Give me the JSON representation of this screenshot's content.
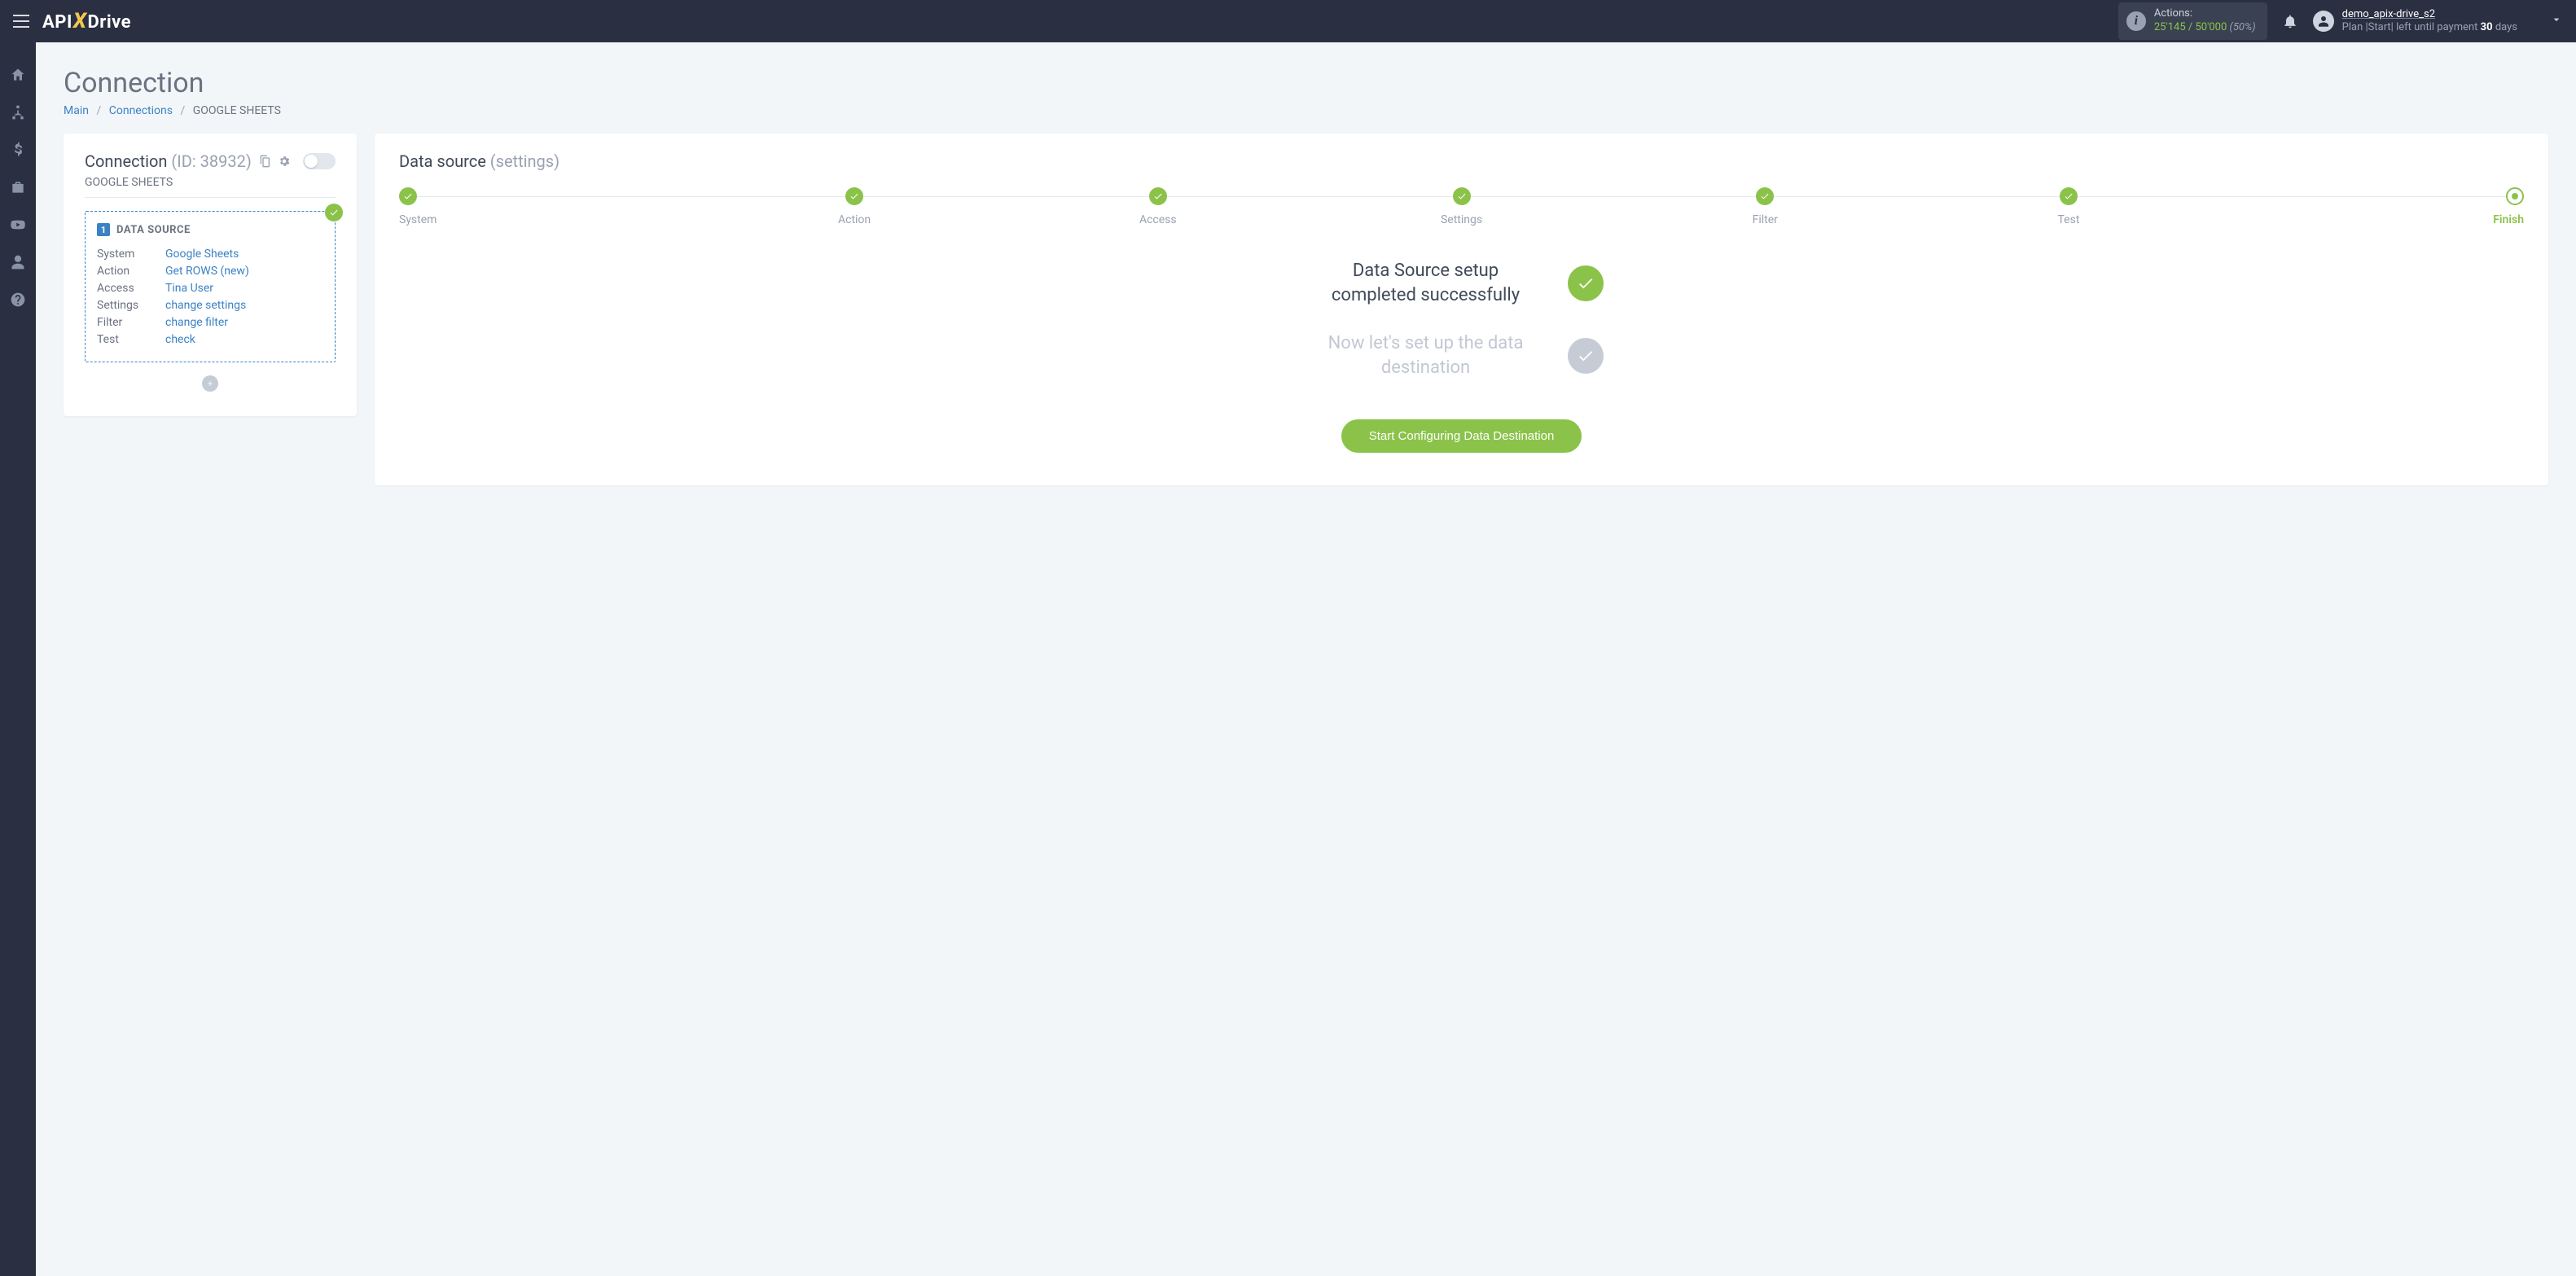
{
  "header": {
    "logo_api": "API",
    "logo_x": "X",
    "logo_drive": "Drive",
    "actions_label": "Actions:",
    "actions_used": "25'145",
    "actions_sep": " / ",
    "actions_total": "50'000",
    "actions_pct": "(50%)",
    "user_name": "demo_apix-drive_s2",
    "user_plan_prefix": "Plan |Start| left until payment ",
    "user_plan_days": "30",
    "user_plan_suffix": " days"
  },
  "page": {
    "title": "Connection",
    "breadcrumb": {
      "main": "Main",
      "connections": "Connections",
      "current": "GOOGLE SHEETS"
    }
  },
  "conn": {
    "title": "Connection ",
    "id": "(ID: 38932)",
    "sub": "GOOGLE SHEETS",
    "ds_num": "1",
    "ds_label": "DATA SOURCE",
    "rows": {
      "system": {
        "k": "System",
        "v": "Google Sheets"
      },
      "action": {
        "k": "Action",
        "v": "Get ROWS (new)"
      },
      "access": {
        "k": "Access",
        "v": "Tina User"
      },
      "settings": {
        "k": "Settings",
        "v": "change settings"
      },
      "filter": {
        "k": "Filter",
        "v": "change filter"
      },
      "test": {
        "k": "Test",
        "v": "check"
      }
    }
  },
  "main": {
    "title": "Data source ",
    "subtitle": "(settings)",
    "steps": {
      "system": "System",
      "action": "Action",
      "access": "Access",
      "settings": "Settings",
      "filter": "Filter",
      "test": "Test",
      "finish": "Finish"
    },
    "status1": "Data Source setup completed successfully",
    "status2": "Now let's set up the data destination",
    "cta": "Start Configuring Data Destination"
  }
}
